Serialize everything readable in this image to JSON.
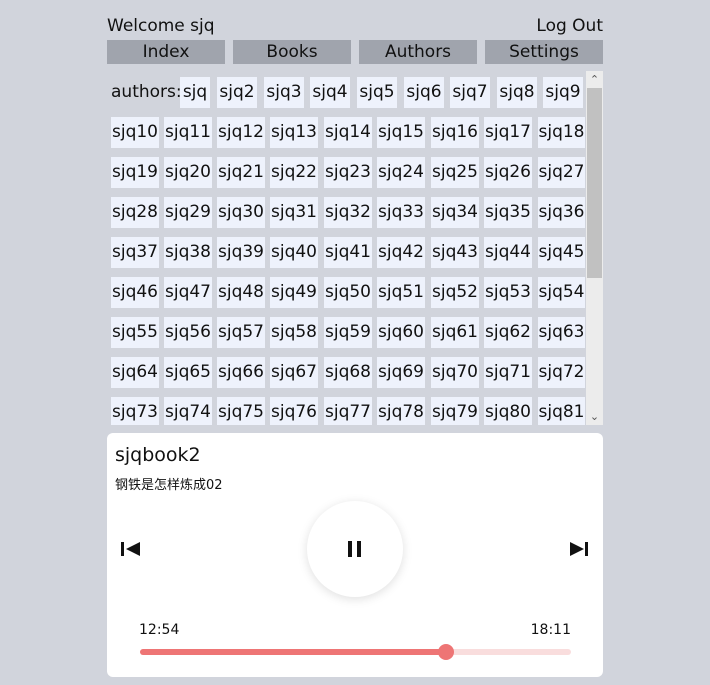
{
  "header": {
    "welcome": "Welcome sjq",
    "logout": "Log Out"
  },
  "nav": [
    {
      "id": "index",
      "label": "Index"
    },
    {
      "id": "books",
      "label": "Books"
    },
    {
      "id": "authors",
      "label": "Authors"
    },
    {
      "id": "settings",
      "label": "Settings"
    }
  ],
  "authors": {
    "label": "authors:",
    "items": [
      "sjq",
      "sjq2",
      "sjq3",
      "sjq4",
      "sjq5",
      "sjq6",
      "sjq7",
      "sjq8",
      "sjq9",
      "sjq10",
      "sjq11",
      "sjq12",
      "sjq13",
      "sjq14",
      "sjq15",
      "sjq16",
      "sjq17",
      "sjq18",
      "sjq19",
      "sjq20",
      "sjq21",
      "sjq22",
      "sjq23",
      "sjq24",
      "sjq25",
      "sjq26",
      "sjq27",
      "sjq28",
      "sjq29",
      "sjq30",
      "sjq31",
      "sjq32",
      "sjq33",
      "sjq34",
      "sjq35",
      "sjq36",
      "sjq37",
      "sjq38",
      "sjq39",
      "sjq40",
      "sjq41",
      "sjq42",
      "sjq43",
      "sjq44",
      "sjq45",
      "sjq46",
      "sjq47",
      "sjq48",
      "sjq49",
      "sjq50",
      "sjq51",
      "sjq52",
      "sjq53",
      "sjq54",
      "sjq55",
      "sjq56",
      "sjq57",
      "sjq58",
      "sjq59",
      "sjq60",
      "sjq61",
      "sjq62",
      "sjq63",
      "sjq64",
      "sjq65",
      "sjq66",
      "sjq67",
      "sjq68",
      "sjq69",
      "sjq70",
      "sjq71",
      "sjq72",
      "sjq73",
      "sjq74",
      "sjq75",
      "sjq76",
      "sjq77",
      "sjq78",
      "sjq79",
      "sjq80",
      "sjq81"
    ]
  },
  "player": {
    "title": "sjqbook2",
    "subtitle": "钢铁是怎样炼成02",
    "current_time": "12:54",
    "total_time": "18:11",
    "progress_fraction": 0.7094,
    "state": "playing",
    "icons": {
      "prev": "skip-previous-icon",
      "play": "pause-icon",
      "next": "skip-next-icon"
    },
    "accent_color": "#ee7575",
    "track_color": "#f9dddd"
  },
  "colors": {
    "background": "#d1d4dc",
    "nav_button": "#a0a4ad",
    "chip": "#eef2fc"
  }
}
